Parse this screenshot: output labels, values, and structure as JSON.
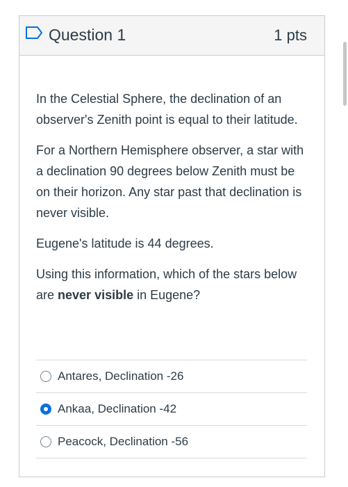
{
  "question": {
    "title": "Question 1",
    "points": "1 pts",
    "paragraph_1": "In the Celestial Sphere, the declination of an observer's Zenith point is equal to their latitude.",
    "paragraph_2": "For a Northern Hemisphere observer, a star with a declination 90 degrees below Zenith must be on their horizon. Any star past that declination is never visible.",
    "paragraph_3": "Eugene's latitude is 44 degrees.",
    "paragraph_4_before": "Using this information, which of the stars below are ",
    "paragraph_4_strong": "never visible",
    "paragraph_4_after": " in Eugene?",
    "flag_icon": "flag-outline-icon"
  },
  "answers": [
    {
      "label": "Antares, Declination -26",
      "selected": false
    },
    {
      "label": "Ankaa, Declination -42",
      "selected": true
    },
    {
      "label": "Peacock, Declination -56",
      "selected": false
    }
  ],
  "colors": {
    "accent": "#0770e3",
    "text": "#2d3b45",
    "border": "#c7cdd1",
    "header_bg": "#f5f5f5"
  }
}
